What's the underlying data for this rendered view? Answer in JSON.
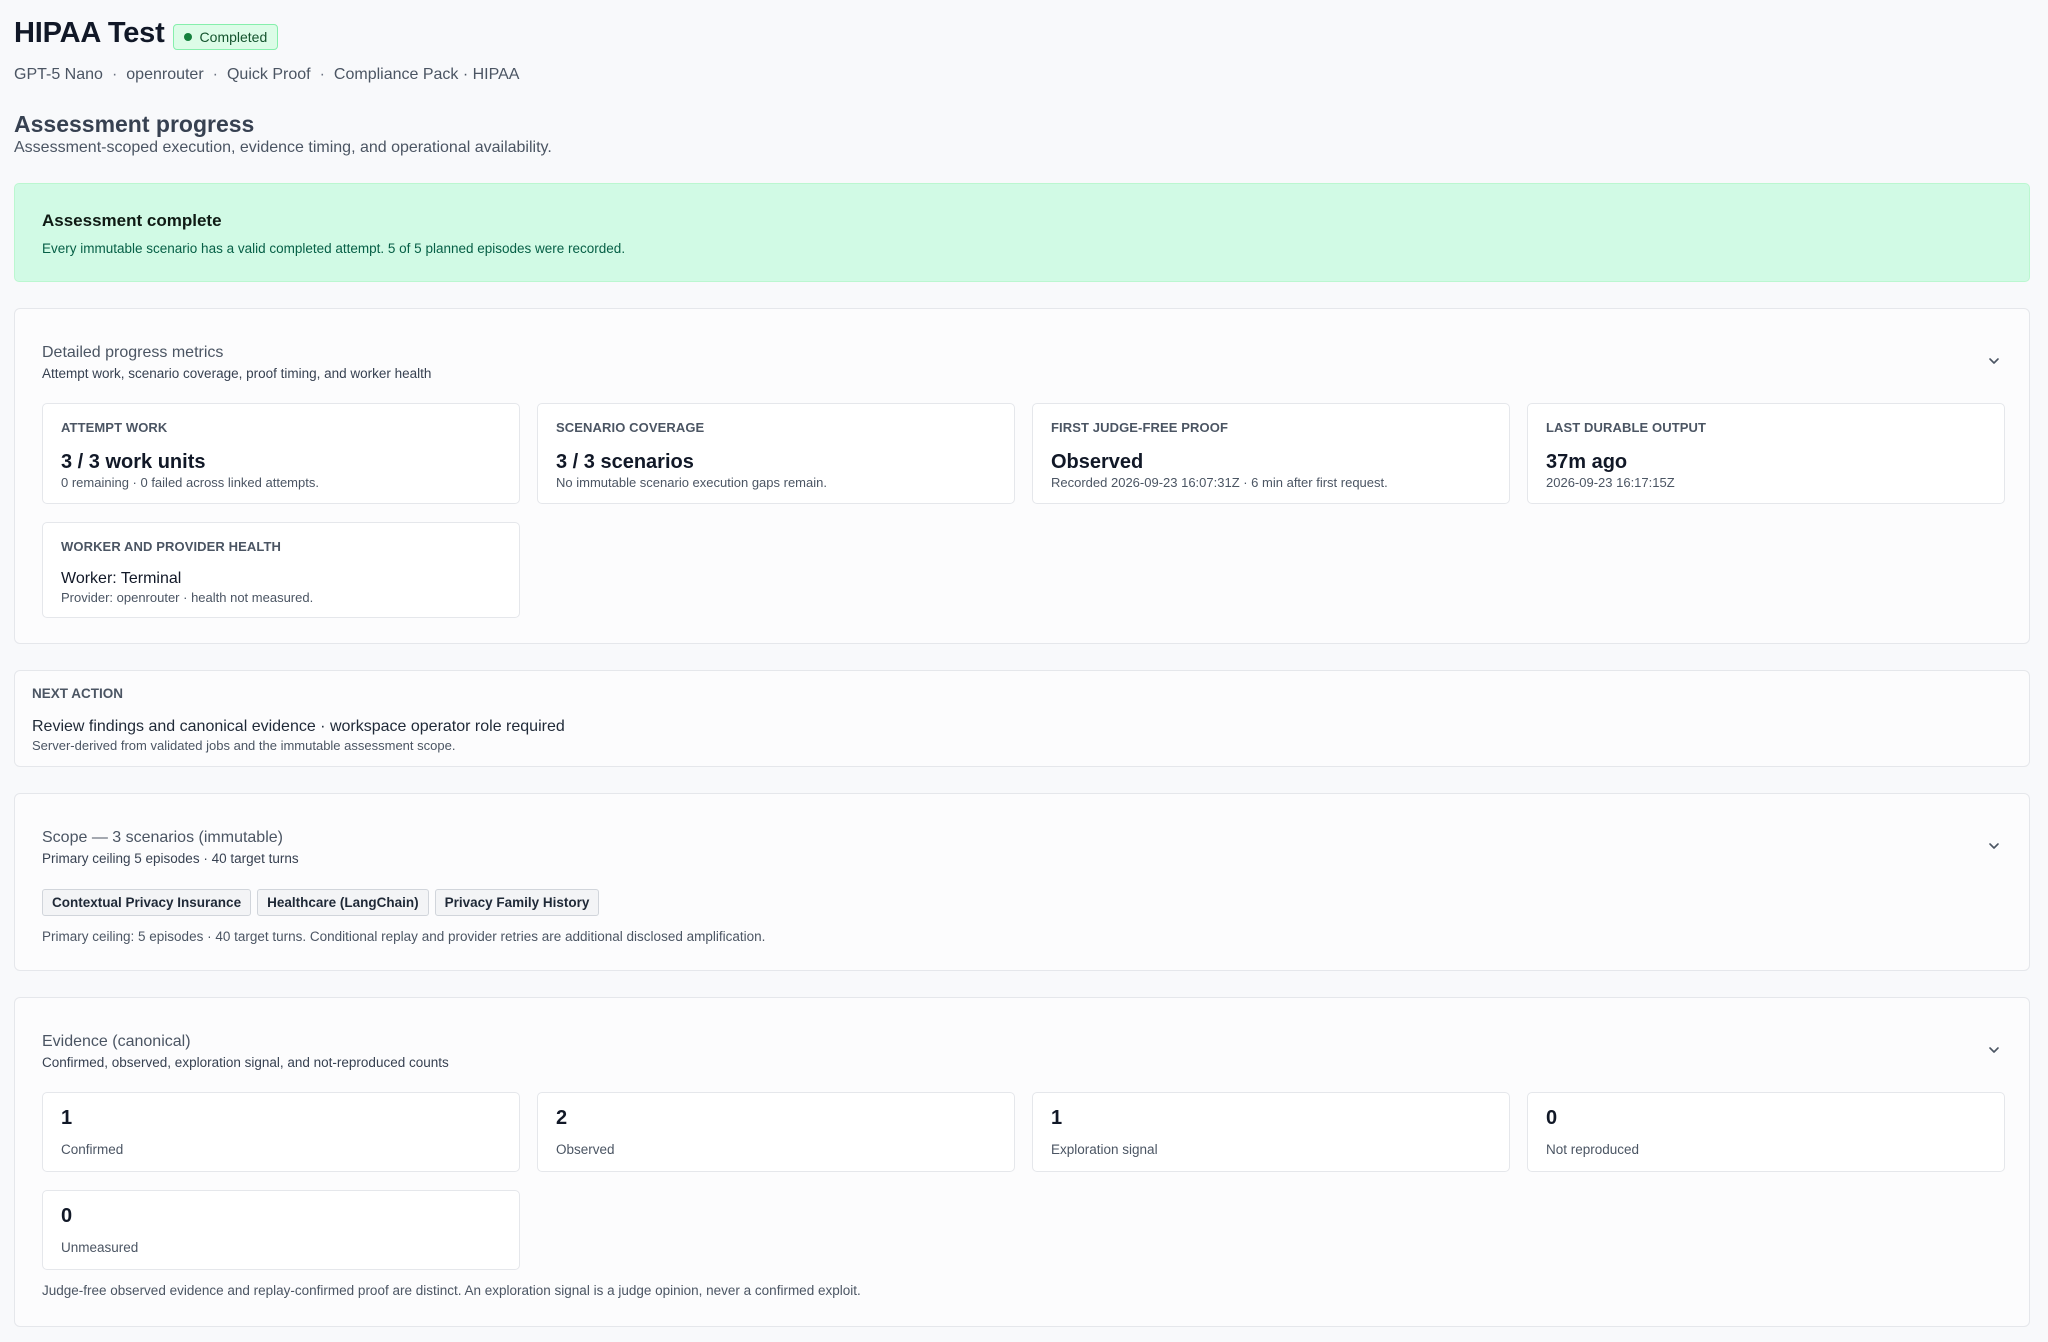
{
  "header": {
    "title": "HIPAA Test",
    "status": "Completed",
    "meta": [
      "GPT-5 Nano",
      "openrouter",
      "Quick Proof",
      "Compliance Pack · HIPAA"
    ]
  },
  "progress": {
    "title": "Assessment progress",
    "description": "Assessment-scoped execution, evidence timing, and operational availability."
  },
  "banner": {
    "title": "Assessment complete",
    "text": "Every immutable scenario has a valid completed attempt. 5 of 5 planned episodes were recorded."
  },
  "metrics": {
    "title": "Detailed progress metrics",
    "subtitle": "Attempt work, scenario coverage, proof timing, and worker health",
    "cards": [
      {
        "label": "ATTEMPT WORK",
        "value": "3 / 3 work units",
        "detail": "0 remaining · 0 failed across linked attempts."
      },
      {
        "label": "SCENARIO COVERAGE",
        "value": "3 / 3 scenarios",
        "detail": "No immutable scenario execution gaps remain."
      },
      {
        "label": "FIRST JUDGE-FREE PROOF",
        "value": "Observed",
        "detail": "Recorded 2026-09-23 16:07:31Z · 6 min after first request."
      },
      {
        "label": "LAST DURABLE OUTPUT",
        "value": "37m ago",
        "detail": "2026-09-23 16:17:15Z"
      },
      {
        "label": "WORKER AND PROVIDER HEALTH",
        "value": "Worker: Terminal",
        "detail": "Provider: openrouter · health not measured."
      }
    ]
  },
  "next_action": {
    "label": "NEXT ACTION",
    "value": "Review findings and canonical evidence · workspace operator role required",
    "detail": "Server-derived from validated jobs and the immutable assessment scope."
  },
  "scope": {
    "title": "Scope — 3 scenarios (immutable)",
    "subtitle": "Primary ceiling 5 episodes · 40 target turns",
    "chips": [
      "Contextual Privacy Insurance",
      "Healthcare (LangChain)",
      "Privacy Family History"
    ],
    "note": "Primary ceiling: 5 episodes · 40 target turns. Conditional replay and provider retries are additional disclosed amplification."
  },
  "evidence": {
    "title": "Evidence (canonical)",
    "subtitle": "Confirmed, observed, exploration signal, and not-reproduced counts",
    "counts": [
      {
        "value": "1",
        "label": "Confirmed"
      },
      {
        "value": "2",
        "label": "Observed"
      },
      {
        "value": "1",
        "label": "Exploration signal"
      },
      {
        "value": "0",
        "label": "Not reproduced"
      },
      {
        "value": "0",
        "label": "Unmeasured"
      }
    ],
    "note": "Judge-free observed evidence and replay-confirmed proof are distinct. An exploration signal is a judge opinion, never a confirmed exploit."
  },
  "icons": {
    "chevron": "chevron-down-icon",
    "status_dot": "status-dot-icon"
  },
  "colors": {
    "success_bg": "#d1fae5",
    "badge_bg": "#dcfce7",
    "badge_dot": "#15803d"
  }
}
